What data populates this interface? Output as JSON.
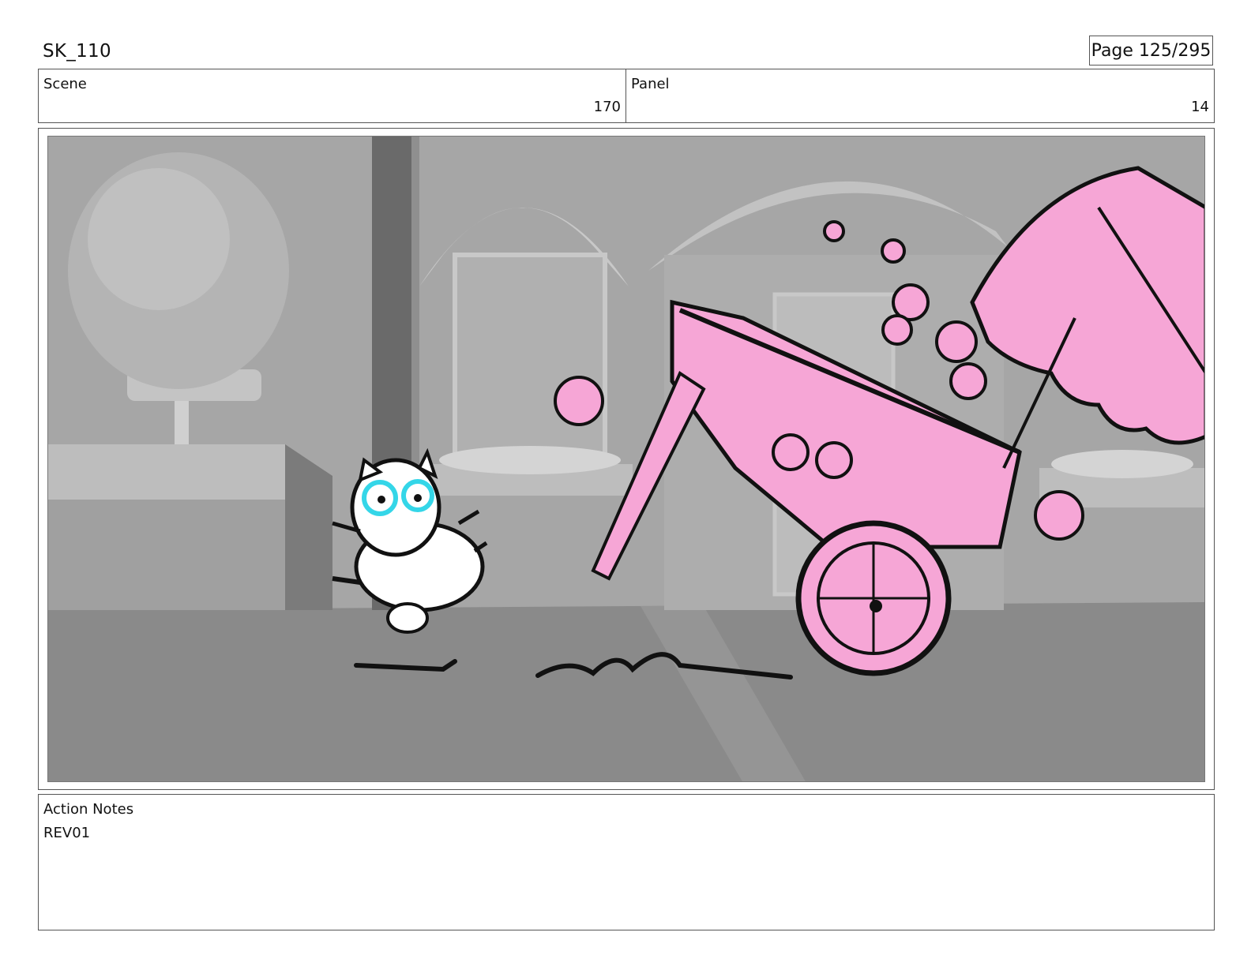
{
  "header": {
    "sequence_id": "SK_110",
    "page_label": "Page 125/295"
  },
  "info": {
    "scene_label": "Scene",
    "scene_value": "170",
    "panel_label": "Panel",
    "panel_value": "14"
  },
  "notes": {
    "label": "Action Notes",
    "text": "REV01"
  },
  "colors": {
    "pink_overlay": "#f6a6d6",
    "cyan_glasses": "#34d6e8",
    "background_grey": "#9a9a9a"
  }
}
